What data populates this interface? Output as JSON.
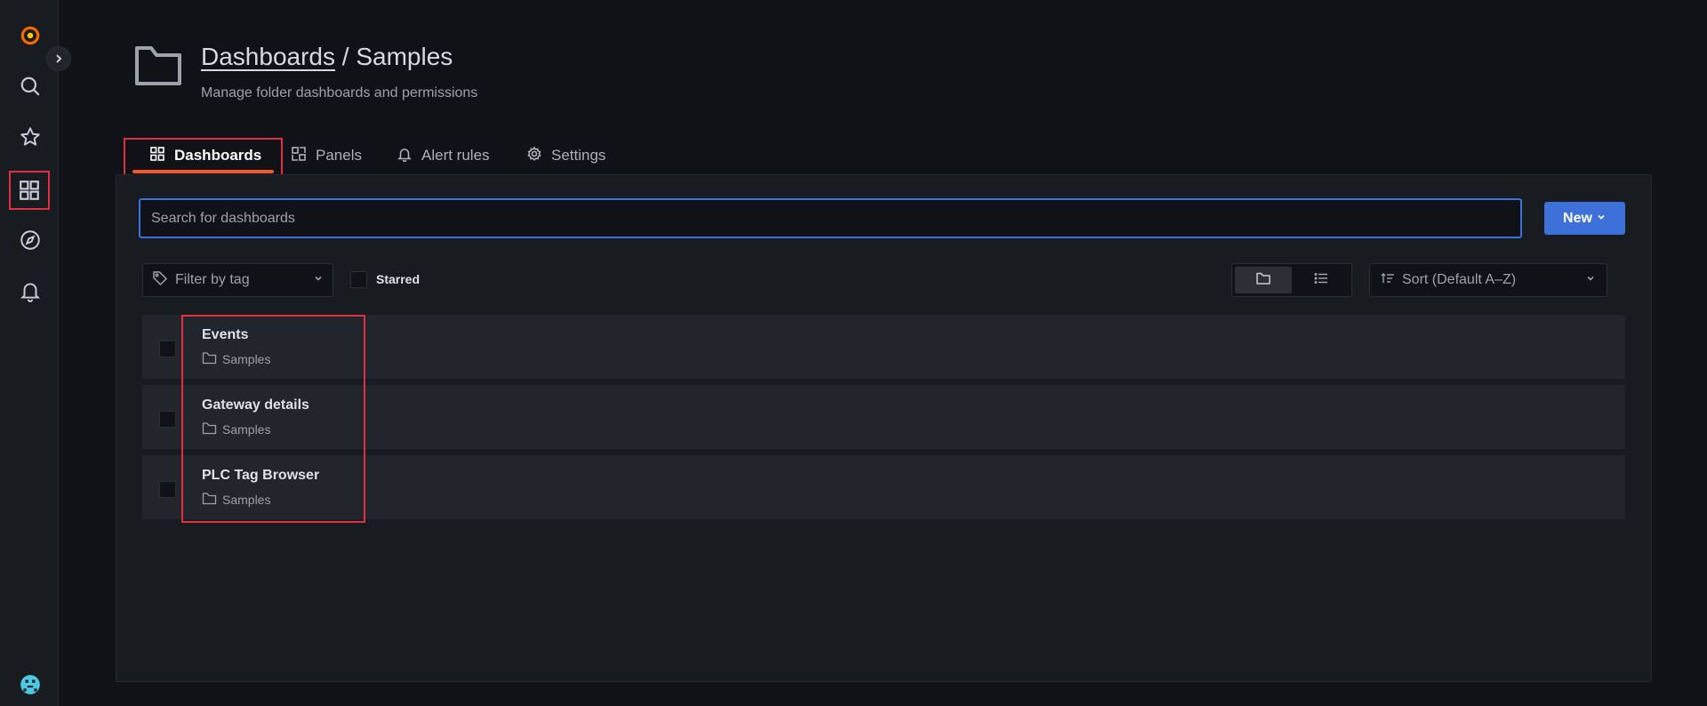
{
  "colors": {
    "background": "#111217",
    "sidebar": "#181b1f",
    "accent_blue": "#3d71d9",
    "active_tab_underline": "#f05a28",
    "highlight_red": "#e02f44",
    "logo_orange": "#f46800"
  },
  "sidebar": {
    "items": [
      {
        "icon": "grafana-logo-icon"
      },
      {
        "icon": "search-icon"
      },
      {
        "icon": "star-icon"
      },
      {
        "icon": "dashboards-grid-icon",
        "active": true
      },
      {
        "icon": "compass-icon"
      },
      {
        "icon": "bell-icon"
      }
    ],
    "expand_icon": "chevron-right-icon",
    "avatar_icon": "user-avatar-icon"
  },
  "header": {
    "breadcrumb": "Dashboards",
    "separator": " / ",
    "current": "Samples",
    "subtitle": "Manage folder dashboards and permissions",
    "icon": "folder-icon"
  },
  "tabs": [
    {
      "label": "Dashboards",
      "icon": "grid-icon",
      "active": true
    },
    {
      "label": "Panels",
      "icon": "panels-icon"
    },
    {
      "label": "Alert rules",
      "icon": "bell-icon"
    },
    {
      "label": "Settings",
      "icon": "gear-icon"
    }
  ],
  "search": {
    "placeholder": "Search for dashboards",
    "value": ""
  },
  "new_button": {
    "label": "New"
  },
  "filter": {
    "label": "Filter by tag"
  },
  "starred": {
    "label": "Starred",
    "checked": false
  },
  "view": {
    "mode": "folders"
  },
  "sort": {
    "label": "Sort (Default A–Z)"
  },
  "dashboards": [
    {
      "title": "Events",
      "folder": "Samples"
    },
    {
      "title": "Gateway details",
      "folder": "Samples"
    },
    {
      "title": "PLC Tag Browser",
      "folder": "Samples"
    }
  ]
}
